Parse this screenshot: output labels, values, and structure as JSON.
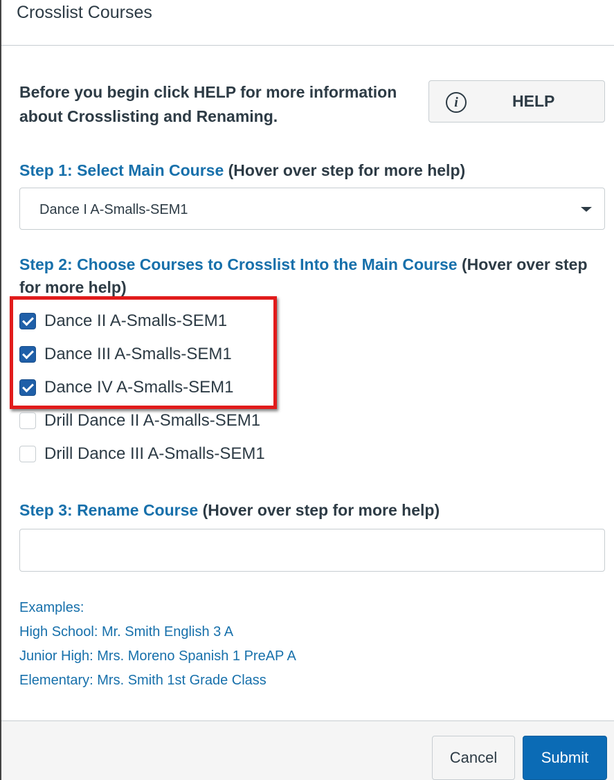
{
  "dialog": {
    "title": "Crosslist Courses"
  },
  "intro": {
    "text": "Before you begin click HELP for more information about Crosslisting and Renaming."
  },
  "help_button": {
    "icon": "info-icon",
    "icon_glyph": "i",
    "label": "HELP"
  },
  "step1": {
    "link": "Step 1: Select Main Course",
    "hint": "(Hover over step for more help)",
    "select": {
      "selected_value": "Dance I A-Smalls-SEM1"
    }
  },
  "step2": {
    "link": "Step 2: Choose Courses to Crosslist Into the Main Course",
    "hint": "(Hover over step for more help)",
    "courses": [
      {
        "label": "Dance II A-Smalls-SEM1",
        "checked": true
      },
      {
        "label": "Dance III A-Smalls-SEM1",
        "checked": true
      },
      {
        "label": "Dance IV A-Smalls-SEM1",
        "checked": true
      },
      {
        "label": "Drill Dance II A-Smalls-SEM1",
        "checked": false
      },
      {
        "label": "Drill Dance III A-Smalls-SEM1",
        "checked": false
      }
    ],
    "highlight_color": "#e11b1b"
  },
  "step3": {
    "link": "Step 3: Rename Course",
    "hint": "(Hover over step for more help)",
    "input_value": "",
    "input_placeholder": ""
  },
  "examples": {
    "heading": "Examples:",
    "items": [
      "High School: Mr. Smith English 3 A",
      "Junior High: Mrs. Moreno Spanish 1 PreAP A",
      "Elementary: Mrs. Smith 1st Grade Class"
    ]
  },
  "footer": {
    "cancel_label": "Cancel",
    "submit_label": "Submit"
  },
  "colors": {
    "link_blue": "#1770ab",
    "primary_button": "#0b6bb5",
    "checkbox_checked": "#1f5fa8",
    "text": "#2d3b45"
  }
}
